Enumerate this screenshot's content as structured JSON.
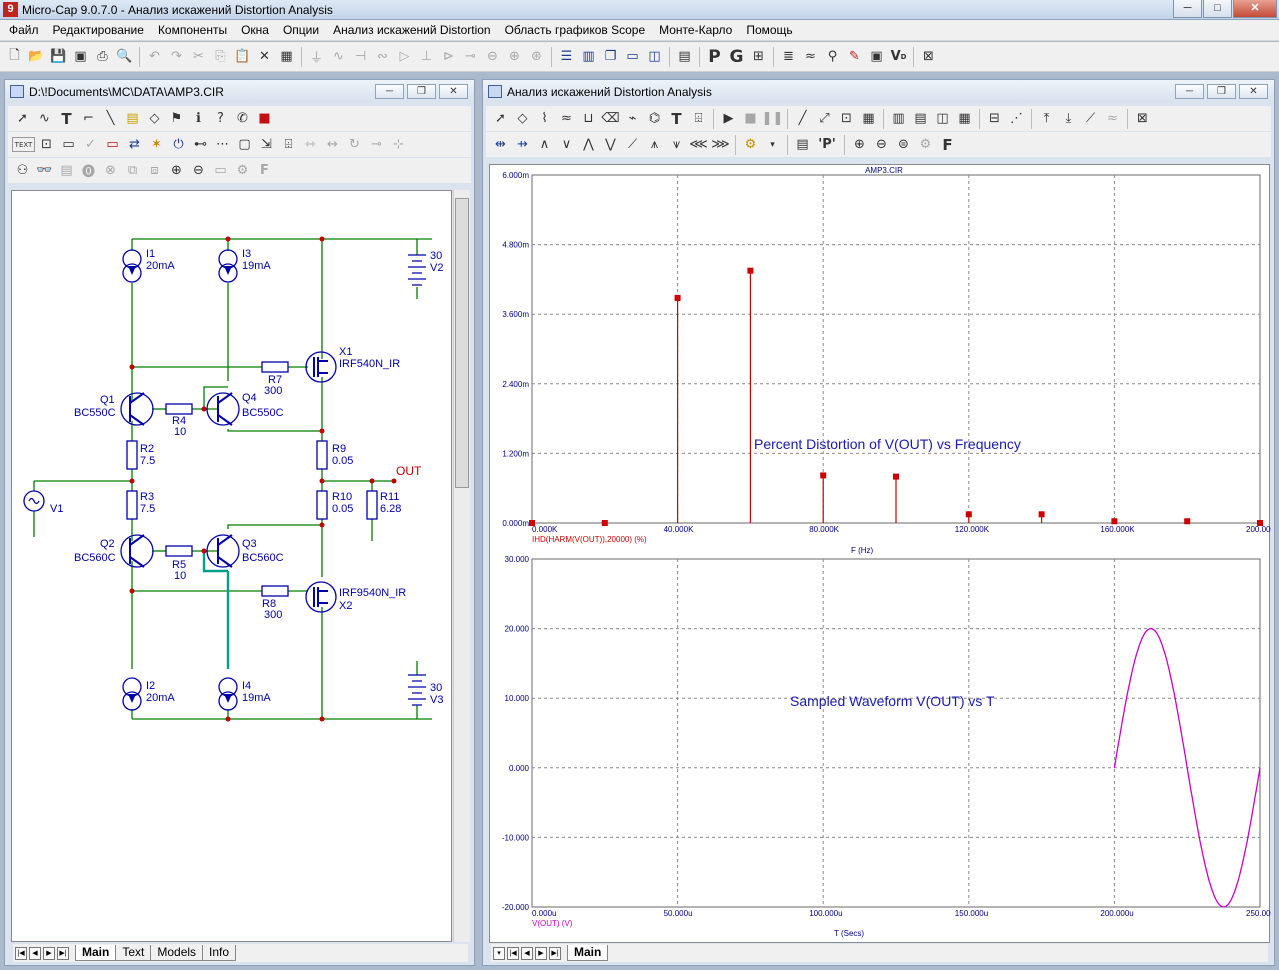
{
  "app": {
    "title": "Micro-Cap 9.0.7.0 - Анализ искажений Distortion Analysis",
    "icon_letter": "9",
    "minimize": "─",
    "maximize": "□",
    "close": "✕"
  },
  "menu": [
    "Файл",
    "Редактирование",
    "Компоненты",
    "Окна",
    "Опции",
    "Анализ искажений Distortion",
    "Область графиков Scope",
    "Монте-Карло",
    "Помощь"
  ],
  "schematic_window": {
    "title": "D:\\!Documents\\MC\\DATA\\AMP3.CIR",
    "text_button": "TEXT",
    "tabs": [
      "Main",
      "Text",
      "Models",
      "Info"
    ],
    "components": {
      "I1": {
        "name": "I1",
        "value": "20mA"
      },
      "I3": {
        "name": "I3",
        "value": "19mA"
      },
      "V2": {
        "name": "V2",
        "value": "30"
      },
      "X1": {
        "name": "X1",
        "model": "IRF540N_IR"
      },
      "R7": {
        "name": "R7",
        "value": "300"
      },
      "Q1": {
        "name": "Q1",
        "model": "BC550C"
      },
      "Q4": {
        "name": "Q4",
        "model": "BC550C"
      },
      "R4": {
        "name": "R4",
        "value": "10"
      },
      "R2": {
        "name": "R2",
        "value": "7.5"
      },
      "R9": {
        "name": "R9",
        "value": "0.05"
      },
      "OUT": "OUT",
      "V1": {
        "name": "V1"
      },
      "R3": {
        "name": "R3",
        "value": "7.5"
      },
      "R10": {
        "name": "R10",
        "value": "0.05"
      },
      "R11": {
        "name": "R11",
        "value": "6.28"
      },
      "Q2": {
        "name": "Q2",
        "model": "BC560C"
      },
      "Q3": {
        "name": "Q3",
        "model": "BC560C"
      },
      "R5": {
        "name": "R5",
        "value": "10"
      },
      "X2": {
        "name": "X2",
        "model": "IRF9540N_IR"
      },
      "R8": {
        "name": "R8",
        "value": "300"
      },
      "I2": {
        "name": "I2",
        "value": "20mA"
      },
      "I4": {
        "name": "I4",
        "value": "19mA"
      },
      "V3": {
        "name": "V3",
        "value": "30"
      }
    }
  },
  "analysis_window": {
    "title": "Анализ искажений Distortion Analysis",
    "tabs": [
      "Main"
    ],
    "toolbar_letters": {
      "T": "T",
      "P": "'P'",
      "F": "F"
    }
  },
  "chart_data": [
    {
      "type": "bar",
      "title": "AMP3.CIR",
      "annotation": "Percent Distortion of V(OUT) vs Frequency",
      "series": [
        {
          "name": "IHD(HARM(V(OUT)),20000) (%)",
          "color": "#cc0000"
        }
      ],
      "xlabel": "F (Hz)",
      "xlim": [
        0,
        200000
      ],
      "ylim": [
        0,
        0.006
      ],
      "x_ticks": [
        "0.000K",
        "40.000K",
        "80.000K",
        "120.000K",
        "160.000K",
        "200.000K"
      ],
      "y_ticks": [
        "0.000m",
        "1.200m",
        "2.400m",
        "3.600m",
        "4.800m",
        "6.000m"
      ],
      "x": [
        0,
        20000,
        40000,
        60000,
        80000,
        100000,
        120000,
        140000,
        160000,
        180000,
        200000
      ],
      "values": [
        0,
        0,
        0.00388,
        0.00435,
        0.00082,
        0.0008,
        0.00015,
        0.00015,
        3e-05,
        3e-05,
        0
      ],
      "grid": true
    },
    {
      "type": "line",
      "annotation": "Sampled Waveform  V(OUT) vs T",
      "series": [
        {
          "name": "V(OUT) (V)",
          "color": "#cc00cc"
        }
      ],
      "xlabel": "T (Secs)",
      "xlim": [
        0,
        0.00025
      ],
      "ylim": [
        -20,
        30
      ],
      "x_ticks": [
        "0.000u",
        "50.000u",
        "100.000u",
        "150.000u",
        "200.000u",
        "250.000u"
      ],
      "y_ticks": [
        "-20.000",
        "-10.000",
        "0.000",
        "10.000",
        "20.000",
        "30.000"
      ],
      "waveform": {
        "start": 0.0002,
        "end": 0.00025,
        "amplitude": 20,
        "frequency": 20000
      },
      "grid": true
    }
  ]
}
